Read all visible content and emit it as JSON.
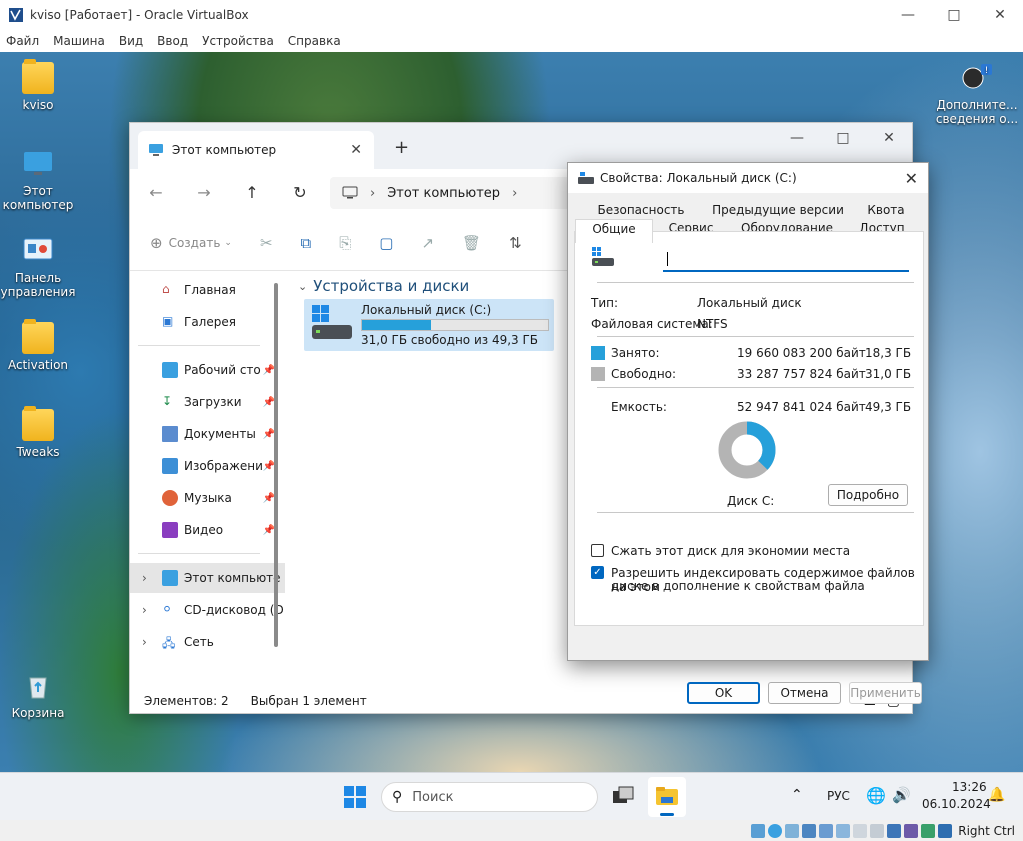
{
  "vbox": {
    "title": "kviso [Работает] - Oracle VirtualBox",
    "menu": [
      "Файл",
      "Машина",
      "Вид",
      "Ввод",
      "Устройства",
      "Справка"
    ],
    "host_key": "Right Ctrl"
  },
  "desktop": {
    "icons": [
      "kviso",
      "Этот компьютер",
      "Панель управления",
      "Activation",
      "Tweaks",
      "Корзина"
    ],
    "notification": "Дополните... сведения о..."
  },
  "explorer": {
    "tab_title": "Этот компьютер",
    "address": "Этот компьютер",
    "create_label": "Создать",
    "nav": {
      "home": "Главная",
      "gallery": "Галерея",
      "desktop": "Рабочий сто",
      "downloads": "Загрузки",
      "documents": "Документы",
      "pictures": "Изображени",
      "music": "Музыка",
      "video": "Видео",
      "this_pc": "Этот компьюте",
      "cd": "CD-дисковод (D",
      "network": "Сеть"
    },
    "section_title": "Устройства и диски",
    "drive": {
      "name": "Локальный диск (C:)",
      "free_text": "31,0 ГБ свободно из 49,3 ГБ",
      "used_fraction": 0.37
    },
    "status_items": "Элементов: 2",
    "status_selected": "Выбран 1 элемент"
  },
  "props": {
    "title": "Свойства: Локальный диск (C:)",
    "tabs_row1": [
      "Безопасность",
      "Предыдущие версии",
      "Квота"
    ],
    "tabs_row2": [
      "Общие",
      "Сервис",
      "Оборудование",
      "Доступ"
    ],
    "type_label": "Тип:",
    "type_value": "Локальный диск",
    "fs_label": "Файловая система:",
    "fs_value": "NTFS",
    "used_label": "Занято:",
    "used_bytes": "19 660 083 200 байт",
    "used_gb": "18,3 ГБ",
    "free_label": "Свободно:",
    "free_bytes": "33 287 757 824 байт",
    "free_gb": "31,0 ГБ",
    "cap_label": "Емкость:",
    "cap_bytes": "52 947 841 024 байт",
    "cap_gb": "49,3 ГБ",
    "disk_label": "Диск C:",
    "details_btn": "Подробно",
    "compress_label": "Сжать этот диск для экономии места",
    "index_label_1": "Разрешить индексировать содержимое файлов на этом",
    "index_label_2": "диске в дополнение к свойствам файла",
    "ok": "OK",
    "cancel": "Отмена",
    "apply": "Применить",
    "used_color": "#26a0da",
    "free_color": "#b4b4b4",
    "used_fraction": 0.371
  },
  "taskbar": {
    "search_placeholder": "Поиск",
    "lang": "РУС",
    "time": "13:26",
    "date": "06.10.2024"
  }
}
